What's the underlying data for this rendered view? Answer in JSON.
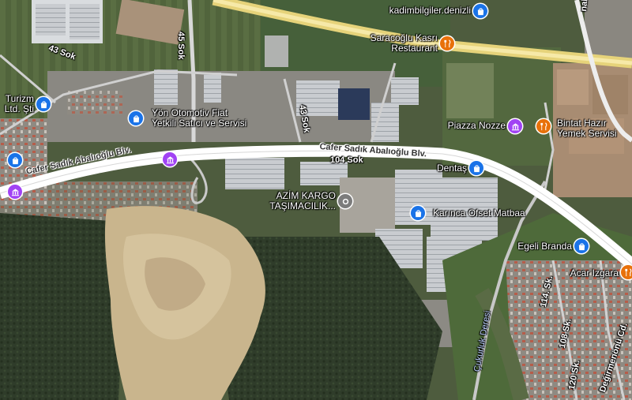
{
  "colors": {
    "shopping": "#1a73e8",
    "food": "#e8710a",
    "attraction": "#a142f4",
    "generic": "#7c7c7c"
  },
  "roads": {
    "main": "Cafer Sadık Abalıoğlu Blv.",
    "main_right": "Cafer Sadık Abalıoğlu Blv.",
    "s104": "104 Sok",
    "s45": "45 Sok",
    "s43a": "43 Sok",
    "s43b": "43 Sok",
    "s114": "114. Sk.",
    "s108": "108 Sk.",
    "s120": "120 Sk.",
    "degirmenonu": "Değirmenönü Cd.",
    "corner_top": "nabi",
    "corner_river": "Çukurluk Deresi"
  },
  "places": [
    {
      "id": "kadim",
      "line1": "kadimbilgiler.denizli",
      "line2": "",
      "icon": "shopping-bag-icon",
      "category": "shopping"
    },
    {
      "id": "saracoglu",
      "line1": "Saracoğlu Kasrı",
      "line2": "Restaurant",
      "icon": "fork-knife-icon",
      "category": "food"
    },
    {
      "id": "turizm",
      "line1": "Turizm",
      "line2": "Ltd. Şti",
      "icon": "shopping-bag-icon",
      "category": "shopping"
    },
    {
      "id": "yon",
      "line1": "Yön Otomotiv Fiat",
      "line2": "Yetkili Satıcı ve Servisi",
      "icon": "shopping-bag-icon",
      "category": "shopping"
    },
    {
      "id": "piazza",
      "line1": "Piazza Nozze",
      "line2": "",
      "icon": "building-icon",
      "category": "attraction"
    },
    {
      "id": "bintat",
      "line1": "Bintat Hazır",
      "line2": "Yemek Servisi",
      "icon": "fork-knife-icon",
      "category": "food"
    },
    {
      "id": "dentas",
      "line1": "Dentaş",
      "line2": "",
      "icon": "shopping-bag-icon",
      "category": "shopping"
    },
    {
      "id": "azim",
      "line1": "AZİM KARGO",
      "line2": "TAŞIMACILIK...",
      "icon": "location-icon",
      "category": "generic"
    },
    {
      "id": "karinca",
      "line1": "Karınca Ofset Matbaa",
      "line2": "",
      "icon": "shopping-bag-icon",
      "category": "shopping"
    },
    {
      "id": "egeli",
      "line1": "Egeli Branda",
      "line2": "",
      "icon": "shopping-bag-icon",
      "category": "shopping"
    },
    {
      "id": "acar",
      "line1": "Acar Izgara",
      "line2": "",
      "icon": "fork-knife-icon",
      "category": "food"
    }
  ]
}
